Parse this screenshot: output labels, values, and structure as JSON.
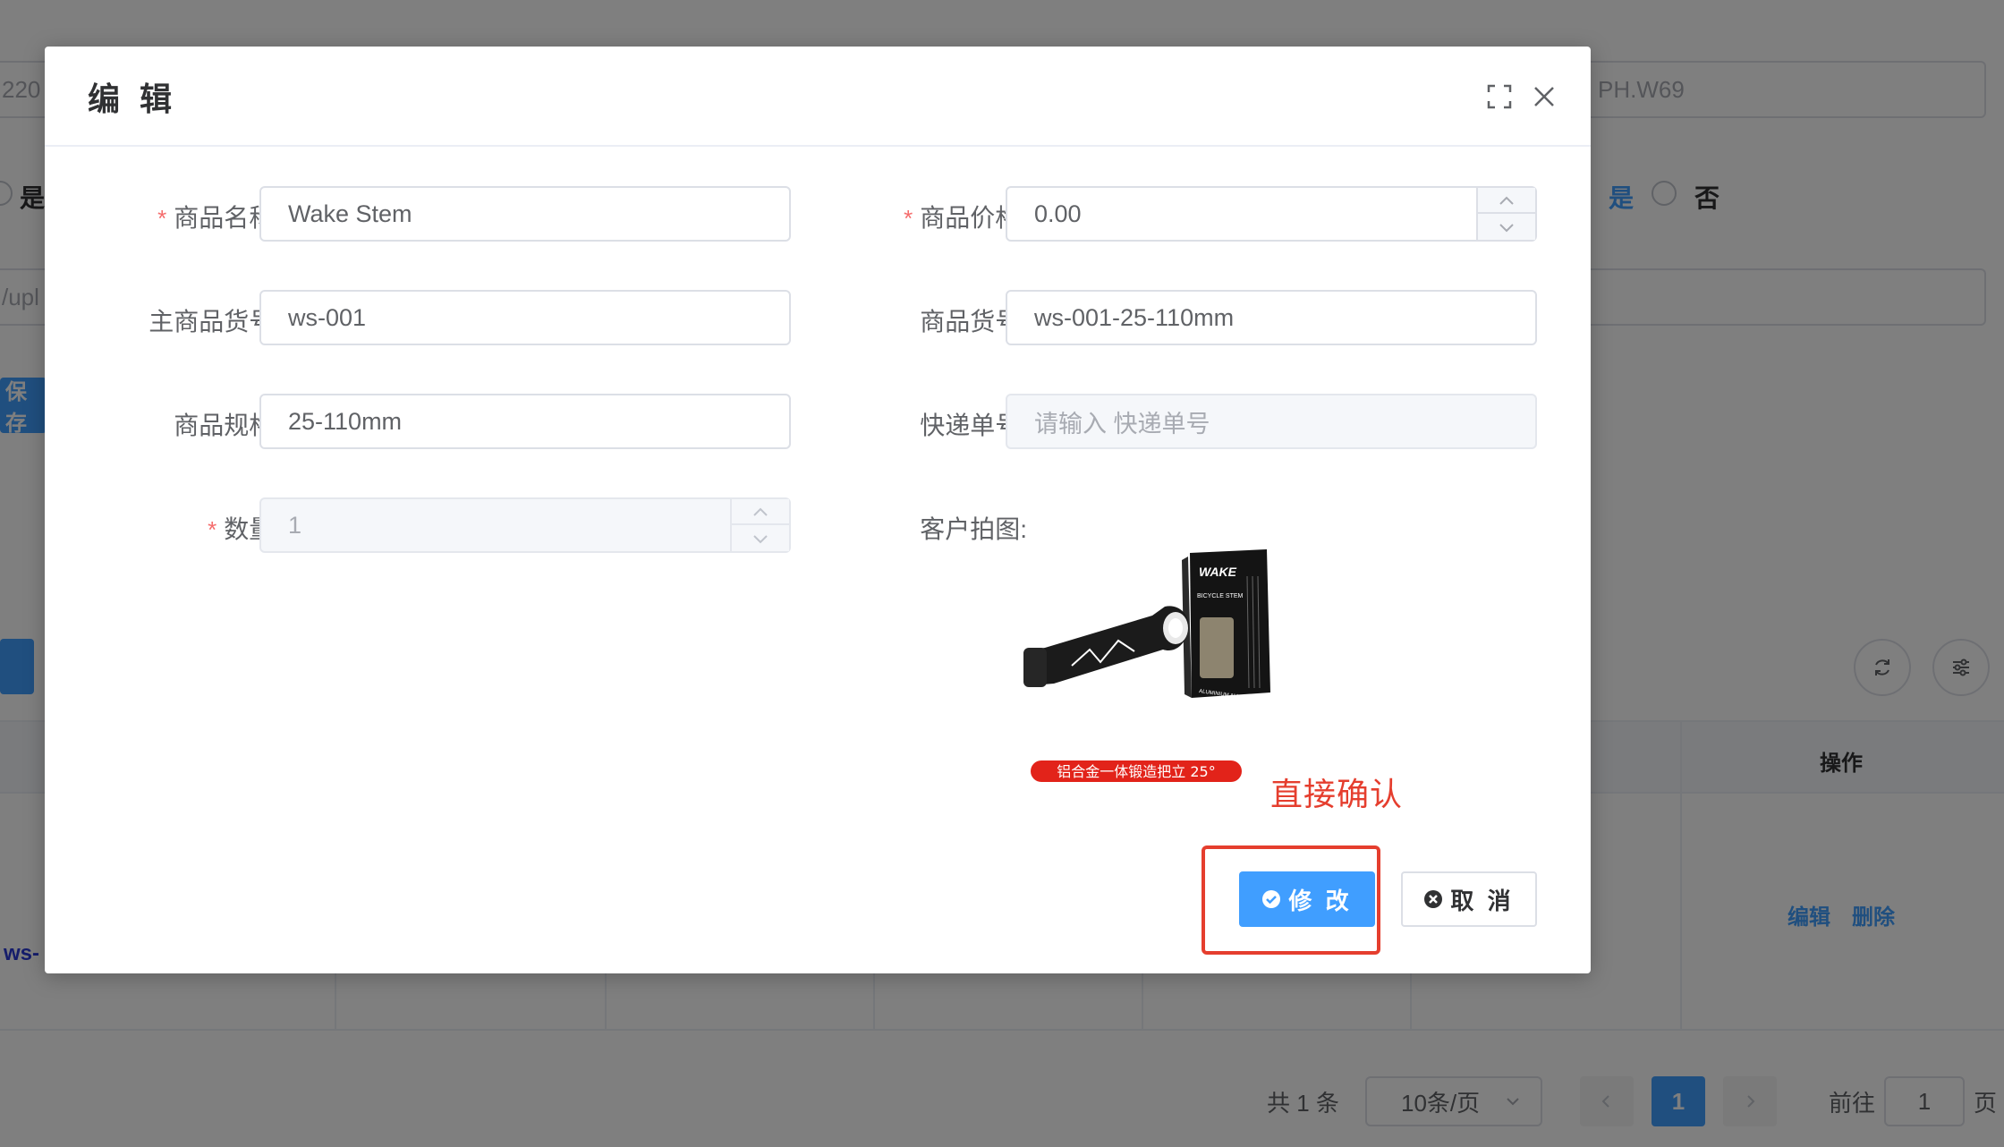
{
  "background": {
    "top_left_input": "220",
    "top_right_input": "PH.W69",
    "radio_left_label": "是",
    "radio_right_yes": "是",
    "radio_right_no": "否",
    "url_input": "/upl",
    "save_button": "保存",
    "table_header_action": "操作",
    "row_code": "ws-",
    "row_edit": "编辑",
    "row_delete": "删除",
    "pagination": {
      "total": "共 1 条",
      "page_size": "10条/页",
      "current_page": "1",
      "goto_label": "前往",
      "goto_value": "1",
      "goto_suffix": "页"
    }
  },
  "dialog": {
    "title": "编 辑",
    "fields": {
      "name": {
        "label": "商品名称:",
        "value": "Wake Stem",
        "required": true
      },
      "price": {
        "label": "商品价格:",
        "value": "0.00",
        "required": true
      },
      "main_sku": {
        "label": "主商品货号:",
        "value": "ws-001"
      },
      "sku": {
        "label": "商品货号:",
        "value": "ws-001-25-110mm"
      },
      "spec": {
        "label": "商品规格:",
        "value": "25-110mm"
      },
      "tracking": {
        "label": "快递单号:",
        "placeholder": "请输入 快递单号"
      },
      "quantity": {
        "label": "数量:",
        "value": "1",
        "required": true
      },
      "photo": {
        "label": "客户拍图:"
      }
    },
    "product_image": {
      "box_brand": "WAKE",
      "box_line1": "BICYCLE STEM",
      "box_line2": "ALUMINIUM ALLOY",
      "banner": "铝合金一体锻造把立 25°"
    },
    "annotation": "直接确认",
    "confirm_button": "修 改",
    "cancel_button": "取 消"
  },
  "colors": {
    "primary": "#409eff",
    "annotation_red": "#e53e2e",
    "required_star": "#f56c6c"
  }
}
